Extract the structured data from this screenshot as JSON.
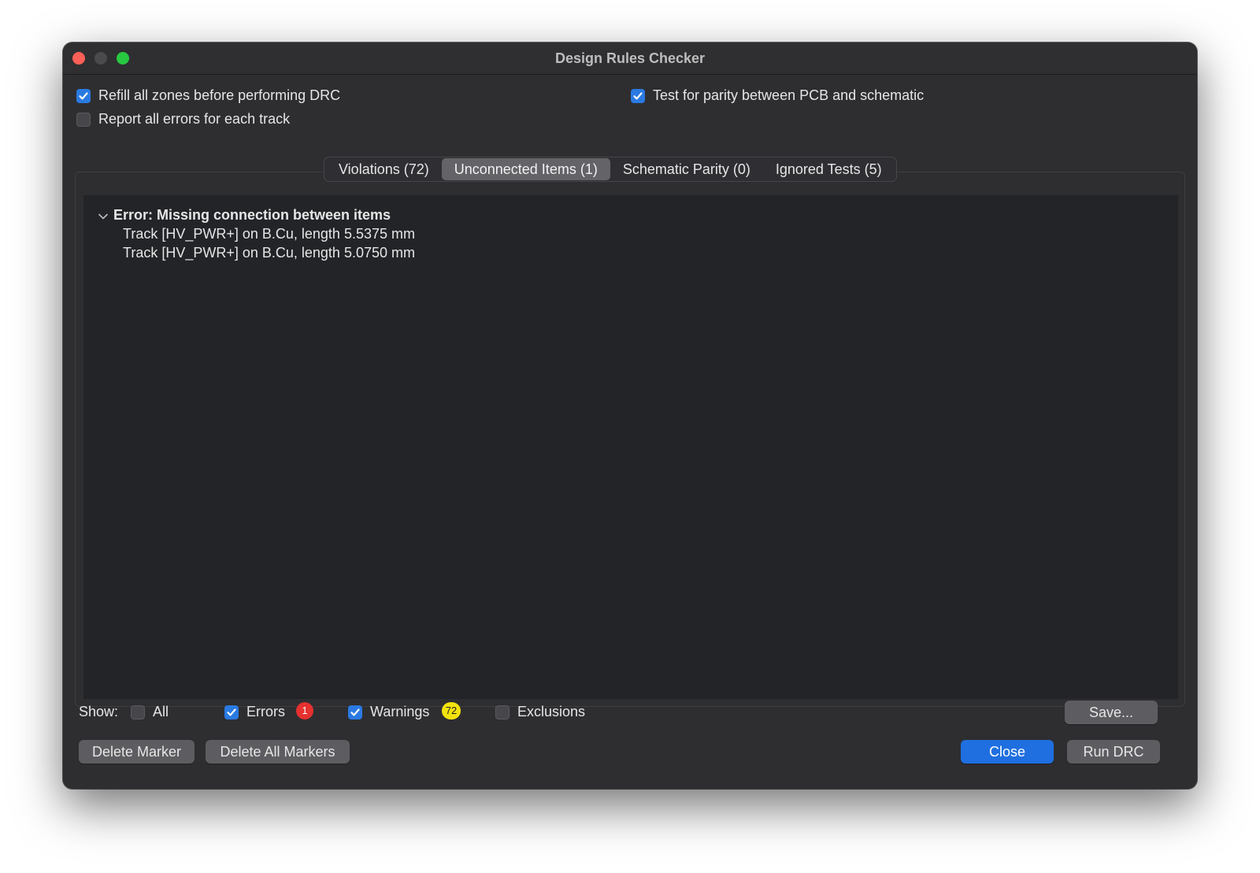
{
  "window": {
    "title": "Design Rules Checker"
  },
  "options": {
    "refill_zones": {
      "label": "Refill all zones before performing DRC",
      "checked": true
    },
    "report_all_errors": {
      "label": "Report all errors for each track",
      "checked": false
    },
    "test_parity": {
      "label": "Test for parity between PCB and schematic",
      "checked": true
    }
  },
  "tabs": [
    {
      "label": "Violations (72)",
      "active": false
    },
    {
      "label": "Unconnected Items (1)",
      "active": true
    },
    {
      "label": "Schematic Parity (0)",
      "active": false
    },
    {
      "label": "Ignored Tests (5)",
      "active": false
    }
  ],
  "tree": {
    "error_title": "Error: Missing connection between items",
    "items": [
      "Track [HV_PWR+] on B.Cu, length 5.5375 mm",
      "Track [HV_PWR+] on B.Cu, length 5.0750 mm"
    ]
  },
  "show": {
    "label": "Show:",
    "all": {
      "label": "All",
      "checked": false
    },
    "errors": {
      "label": "Errors",
      "checked": true,
      "count": "1"
    },
    "warnings": {
      "label": "Warnings",
      "checked": true,
      "count": "72"
    },
    "exclusions": {
      "label": "Exclusions",
      "checked": false
    }
  },
  "buttons": {
    "save": "Save...",
    "delete_marker": "Delete Marker",
    "delete_all_markers": "Delete All Markers",
    "close": "Close",
    "run_drc": "Run DRC"
  },
  "colors": {
    "accent": "#1f6fe0",
    "checkbox_on": "#2a7ae2",
    "error_badge": "#e5312f",
    "warning_badge": "#f2e30d"
  }
}
